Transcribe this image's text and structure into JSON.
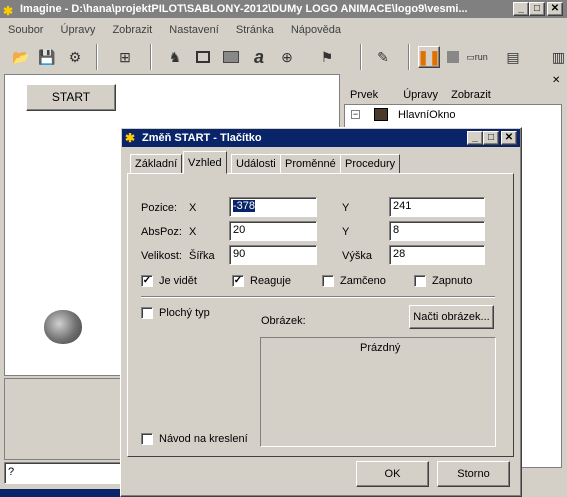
{
  "app": {
    "title": "Imagine - D:\\hana\\projektPILOT\\SABLONY-2012\\DUMy LOGO ANIMACE\\logo9\\vesmi...",
    "menu": [
      "Soubor",
      "Úpravy",
      "Zobrazit",
      "Nastavení",
      "Stránka",
      "Nápověda"
    ],
    "start_button": "START",
    "command_prompt": "?"
  },
  "tree_panel": {
    "menu": [
      "Prvek",
      "Úpravy",
      "Zobrazit"
    ],
    "root_node": "HlavníOkno"
  },
  "dialog": {
    "title": "Změň START  - Tlačítko",
    "tabs": [
      "Základní",
      "Vzhled",
      "Události",
      "Proměnné",
      "Procedury"
    ],
    "active_tab": "Vzhled",
    "labels": {
      "pozice": "Pozice:",
      "abspoz": "AbsPoz:",
      "velikost": "Velikost:",
      "x": "X",
      "y": "Y",
      "sirka": "Šířka",
      "vyska": "Výška",
      "obrazek": "Obrázek:",
      "prazdny": "Prázdný"
    },
    "fields": {
      "pozice_x": "-378",
      "pozice_y": "241",
      "abspoz_x": "20",
      "abspoz_y": "8",
      "sirka": "90",
      "vyska": "28"
    },
    "checkboxes": {
      "je_videt": {
        "label": "Je vidět",
        "checked": true
      },
      "reaguje": {
        "label": "Reaguje",
        "checked": true
      },
      "zamceno": {
        "label": "Zamčeno",
        "checked": false
      },
      "zapnuto": {
        "label": "Zapnuto",
        "checked": false
      },
      "plochy_typ": {
        "label": "Plochý typ",
        "checked": false
      },
      "navod": {
        "label": "Návod na kreslení",
        "checked": false
      }
    },
    "buttons": {
      "load_image": "Načti obrázek...",
      "ok": "OK",
      "cancel": "Storno"
    }
  }
}
